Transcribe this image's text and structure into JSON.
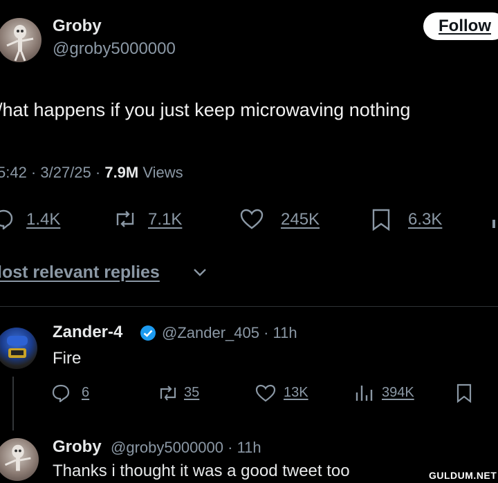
{
  "tweet": {
    "author_name": "Groby",
    "author_handle": "@groby5000000",
    "follow_label": "Follow",
    "text": "/hat happens if you just keep microwaving nothing",
    "time_date": "5:42 · 3/27/25 · ",
    "views_count": "7.9M",
    "views_label": " Views",
    "stats": {
      "replies": "1.4K",
      "reposts": "7.1K",
      "likes": "245K",
      "bookmarks": "6.3K"
    }
  },
  "replies_filter": {
    "label": "lost relevant replies"
  },
  "replies": [
    {
      "name": "Zander-4",
      "verified": true,
      "handle_time": "@Zander_405 · 11h",
      "text": "Fire",
      "stats": {
        "replies": "6",
        "reposts": "35",
        "likes": "13K",
        "views": "394K"
      }
    },
    {
      "name": "Groby",
      "handle_time": "@groby5000000 · 11h",
      "text": "Thanks i thought it was a good tweet too"
    }
  ],
  "watermark": "GULDUM.NET",
  "colors": {
    "background": "#000000",
    "text": "#e7e9ea",
    "muted": "#8b98a5",
    "verified": "#1d9bf0",
    "separator": "#2f3336"
  }
}
